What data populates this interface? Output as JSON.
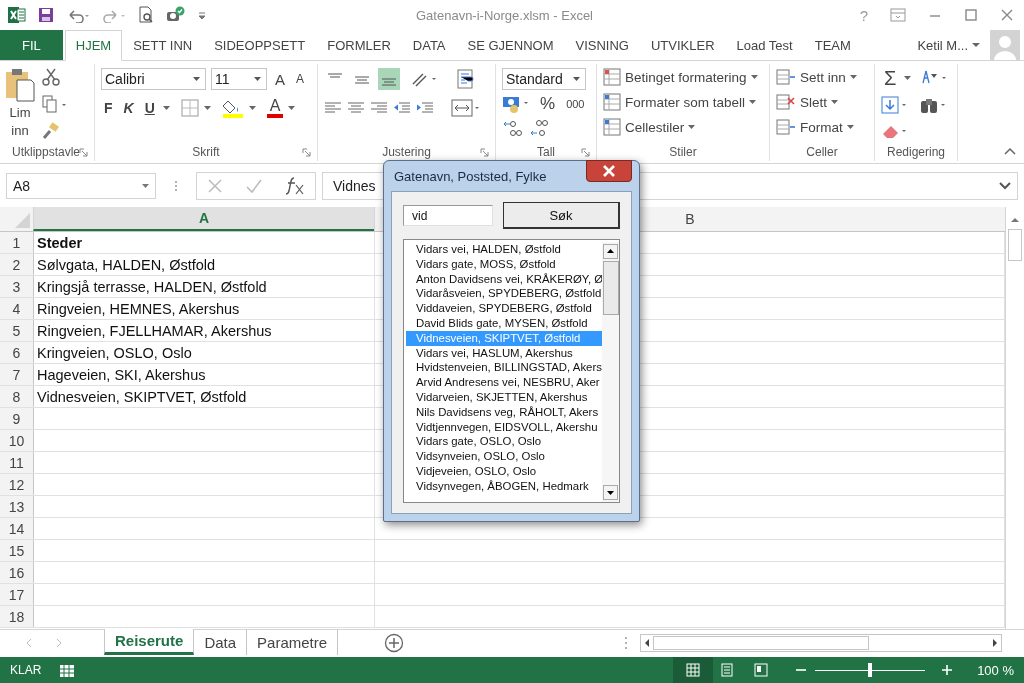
{
  "title_bar": {
    "title": "Gatenavn-i-Norge.xlsm - Excel",
    "help": "?"
  },
  "ribbon_tabs": [
    {
      "label": "FIL",
      "kind": "file",
      "selected": false
    },
    {
      "label": "HJEM",
      "kind": "tab",
      "selected": true
    },
    {
      "label": "SETT INN",
      "kind": "tab",
      "selected": false
    },
    {
      "label": "SIDEOPPSETT",
      "kind": "tab",
      "selected": false
    },
    {
      "label": "FORMLER",
      "kind": "tab",
      "selected": false
    },
    {
      "label": "DATA",
      "kind": "tab",
      "selected": false
    },
    {
      "label": "SE GJENNOM",
      "kind": "tab",
      "selected": false
    },
    {
      "label": "VISNING",
      "kind": "tab",
      "selected": false
    },
    {
      "label": "UTVIKLER",
      "kind": "tab",
      "selected": false
    },
    {
      "label": "Load Test",
      "kind": "tab",
      "selected": false
    },
    {
      "label": "TEAM",
      "kind": "tab",
      "selected": false
    }
  ],
  "account": {
    "name": "Ketil M..."
  },
  "ribbon": {
    "clipboard": {
      "paste": "Lim inn",
      "label": "Utklippstavle"
    },
    "font": {
      "family": "Calibri",
      "size": "11",
      "grow": "A",
      "shrink": "A",
      "bold": "F",
      "italic": "K",
      "underline": "U",
      "color_letter": "A",
      "label": "Skrift"
    },
    "alignment": {
      "vertical": [
        {
          "selected": false
        },
        {
          "selected": false
        },
        {
          "selected": true
        }
      ],
      "label": "Justering"
    },
    "number": {
      "format": "Standard",
      "percent": "%",
      "thousands": "000",
      "label": "Tall"
    },
    "styles": {
      "items": [
        "Betinget formatering",
        "Formater som tabell",
        "Cellestiler"
      ],
      "label": "Stiler"
    },
    "cells": {
      "items": [
        "Sett inn",
        "Slett",
        "Format"
      ],
      "label": "Celler"
    },
    "editing": {
      "sum": "Σ",
      "label": "Redigering"
    }
  },
  "formula_bar": {
    "name_box": "A8",
    "formula": "Vidnes"
  },
  "sheet": {
    "columns": [
      {
        "label": "A",
        "selected": true
      },
      {
        "label": "B",
        "selected": false
      }
    ],
    "rows": [
      {
        "number": "1",
        "cell_a": "Steder",
        "bold": true
      },
      {
        "number": "2",
        "cell_a": "Sølvgata, HALDEN, Østfold",
        "bold": false
      },
      {
        "number": "3",
        "cell_a": "Kringsjå terrasse, HALDEN, Østfold",
        "bold": false
      },
      {
        "number": "4",
        "cell_a": "Ringveien, HEMNES, Akershus",
        "bold": false
      },
      {
        "number": "5",
        "cell_a": "Ringveien, FJELLHAMAR, Akershus",
        "bold": false
      },
      {
        "number": "6",
        "cell_a": "Kringveien, OSLO, Oslo",
        "bold": false
      },
      {
        "number": "7",
        "cell_a": "Hageveien, SKI, Akershus",
        "bold": false
      },
      {
        "number": "8",
        "cell_a": "Vidnesveien, SKIPTVET, Østfold",
        "bold": false
      },
      {
        "number": "9"
      },
      {
        "number": "10"
      },
      {
        "number": "11"
      },
      {
        "number": "12"
      },
      {
        "number": "13"
      },
      {
        "number": "14"
      },
      {
        "number": "15"
      },
      {
        "number": "16"
      },
      {
        "number": "17"
      },
      {
        "number": "18"
      }
    ]
  },
  "sheet_tabs": [
    {
      "label": "Reiserute",
      "selected": true
    },
    {
      "label": "Data",
      "selected": false
    },
    {
      "label": "Parametre",
      "selected": false
    }
  ],
  "status_bar": {
    "status": "KLAR",
    "zoom": {
      "level": 0.5,
      "reading": "100 %"
    }
  },
  "dialog": {
    "title": "Gatenavn, Poststed, Fylke",
    "search": {
      "value": "vid"
    },
    "button": "Søk",
    "items": [
      {
        "text": "Vidars vei, HALDEN, Østfold",
        "selected": false
      },
      {
        "text": "Vidars gate, MOSS, Østfold",
        "selected": false
      },
      {
        "text": "Anton Davidsens vei, KRÅKERØY, Ø",
        "selected": false
      },
      {
        "text": "Vidaråsveien, SPYDEBERG, Østfold",
        "selected": false
      },
      {
        "text": "Viddaveien, SPYDEBERG, Østfold",
        "selected": false
      },
      {
        "text": "David Blids gate, MYSEN, Østfold",
        "selected": false
      },
      {
        "text": "Vidnesveien, SKIPTVET, Østfold",
        "selected": true
      },
      {
        "text": "Vidars vei, HASLUM, Akershus",
        "selected": false
      },
      {
        "text": "Hvidstenveien, BILLINGSTAD, Akers",
        "selected": false
      },
      {
        "text": "Arvid Andresens vei, NESBRU, Aker",
        "selected": false
      },
      {
        "text": "Vidarveien, SKJETTEN, Akershus",
        "selected": false
      },
      {
        "text": "Nils Davidsens veg, RÅHOLT, Akers",
        "selected": false
      },
      {
        "text": "Vidtjennvegen, EIDSVOLL, Akershu",
        "selected": false
      },
      {
        "text": "Vidars gate, OSLO, Oslo",
        "selected": false
      },
      {
        "text": "Vidsynveien, OSLO, Oslo",
        "selected": false
      },
      {
        "text": "Vidjeveien, OSLO, Oslo",
        "selected": false
      },
      {
        "text": "Vidsynvegen, ÅBOGEN, Hedmark",
        "selected": false
      }
    ]
  }
}
